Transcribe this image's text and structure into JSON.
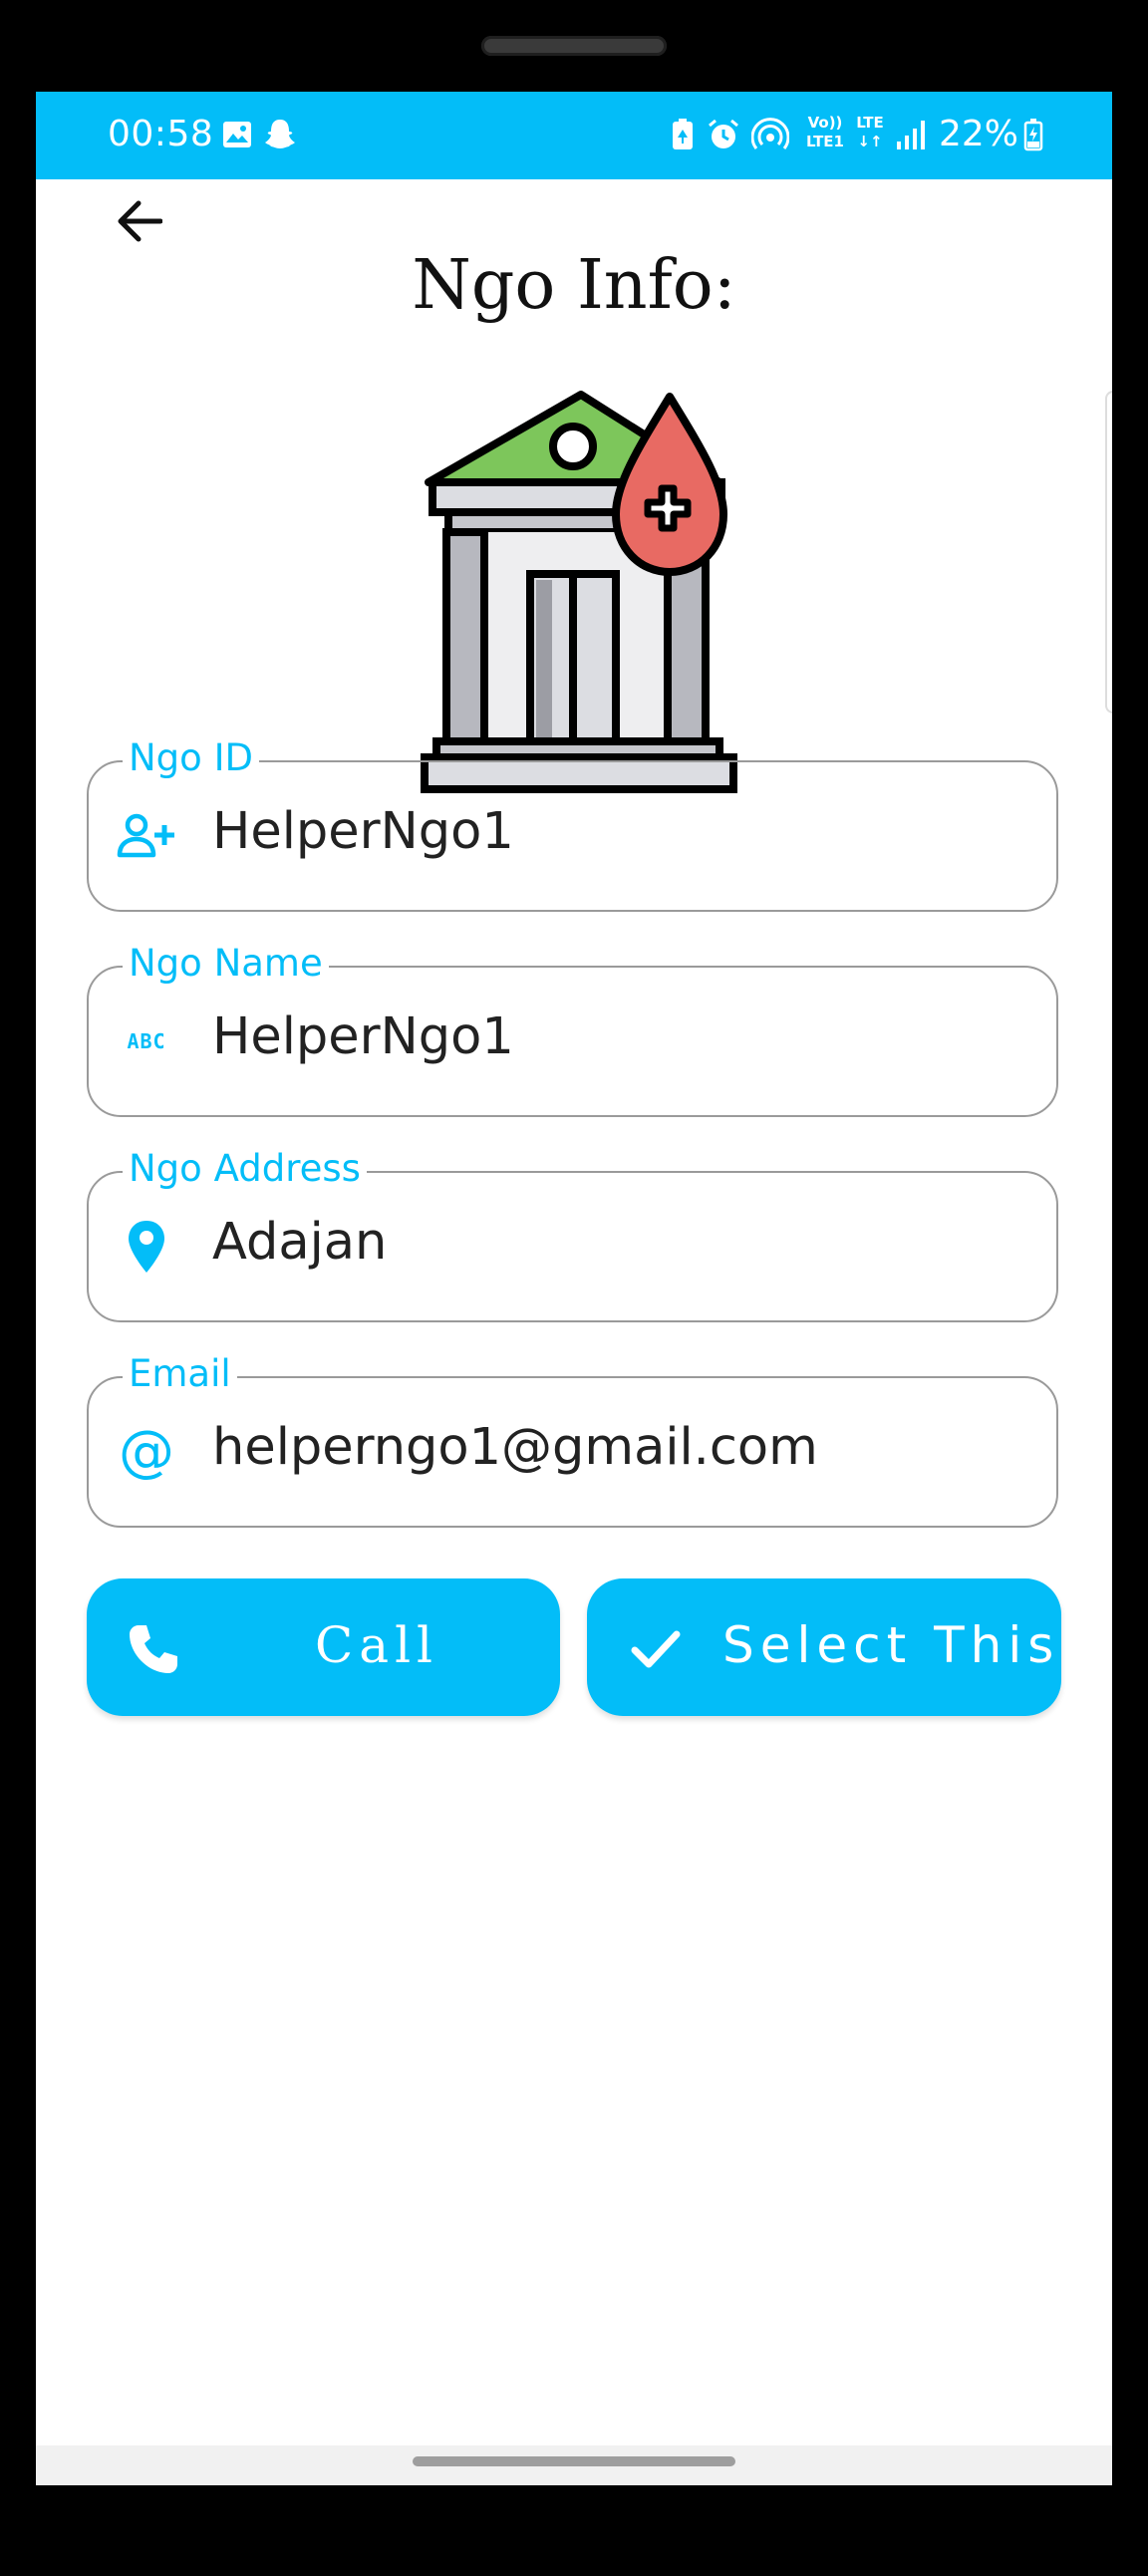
{
  "status_bar": {
    "time": "00:58",
    "battery": "22%",
    "network_vo": "Vo))",
    "network_lte1": "LTE1",
    "network_lte": "LTE",
    "icons": [
      "gallery-icon",
      "snapchat-icon",
      "battery-saver-icon",
      "alarm-icon",
      "hotspot-icon",
      "volte-icon",
      "lte-icon",
      "signal-icon",
      "battery-icon"
    ],
    "bg_color": "#03bdf8"
  },
  "header": {
    "title": "Ngo Info:",
    "back_icon": "arrow-back-icon"
  },
  "hero_image": "ngo-building-blood-drop-icon",
  "fields": [
    {
      "label": "Ngo ID",
      "value": "HelperNgo1",
      "icon": "person-add-icon"
    },
    {
      "label": "Ngo Name",
      "value": "HelperNgo1",
      "icon": "abc-icon",
      "icon_text": "ABC"
    },
    {
      "label": "Ngo Address",
      "value": "Adajan",
      "icon": "location-pin-icon"
    },
    {
      "label": "Email",
      "value": "helperngo1@gmail.com",
      "icon": "at-sign-icon",
      "icon_text": "@"
    }
  ],
  "buttons": {
    "call": {
      "label": "Call",
      "icon": "phone-icon"
    },
    "select": {
      "label": "Select This",
      "icon": "check-icon"
    }
  },
  "accent_color": "#03bdf8"
}
